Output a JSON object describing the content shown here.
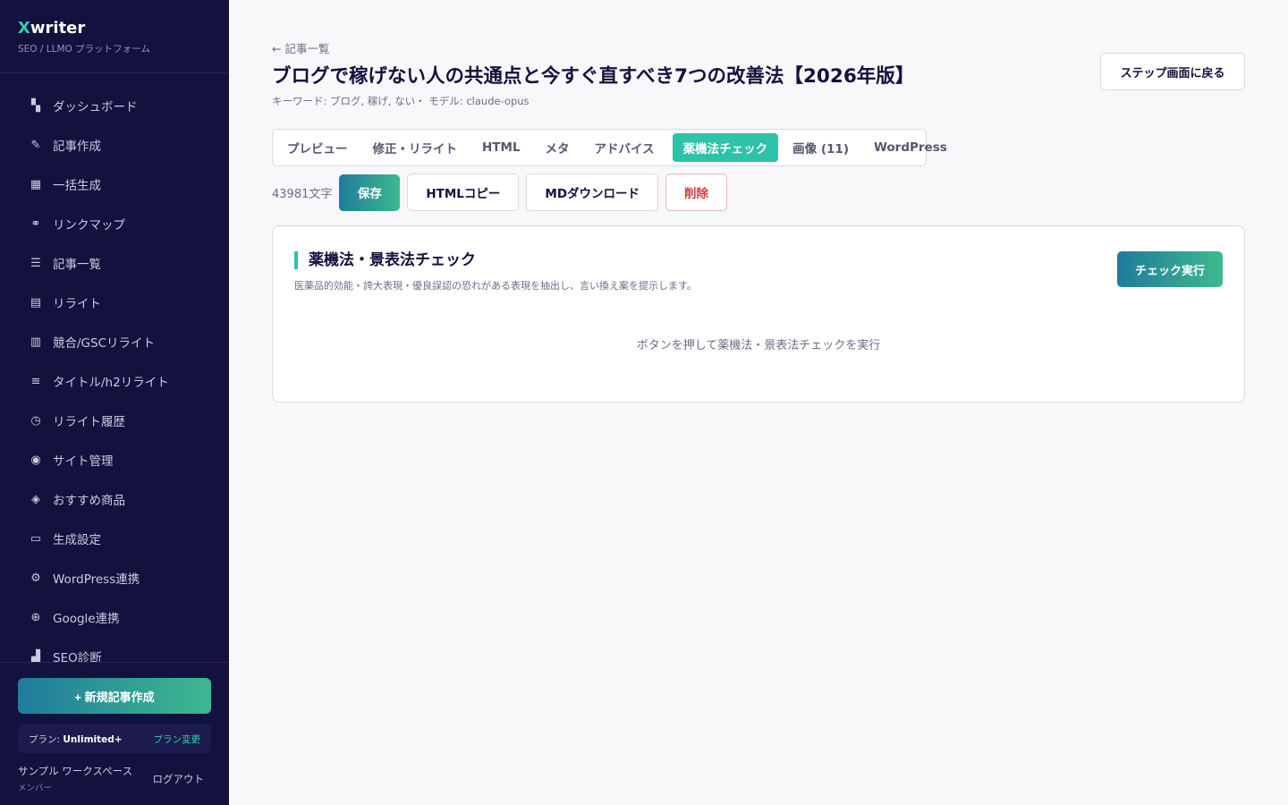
{
  "brand": {
    "x": "X",
    "rest": "writer",
    "subtitle": "SEO / LLMO プラットフォーム"
  },
  "sidebar": {
    "items": [
      {
        "label": "ダッシュボード",
        "icon": "dashboard-icon"
      },
      {
        "label": "記事作成",
        "icon": "pencil-icon"
      },
      {
        "label": "一括生成",
        "icon": "grid-add-icon"
      },
      {
        "label": "リンクマップ",
        "icon": "link-map-icon"
      },
      {
        "label": "記事一覧",
        "icon": "list-icon"
      },
      {
        "label": "リライト",
        "icon": "document-icon"
      },
      {
        "label": "競合/GSCリライト",
        "icon": "book-icon"
      },
      {
        "label": "タイトル/h2リライト",
        "icon": "heading-icon"
      },
      {
        "label": "リライト履歴",
        "icon": "clock-icon"
      },
      {
        "label": "サイト管理",
        "icon": "site-icon"
      },
      {
        "label": "おすすめ商品",
        "icon": "tag-icon"
      },
      {
        "label": "生成設定",
        "icon": "settings-box-icon"
      },
      {
        "label": "WordPress連携",
        "icon": "gear-icon"
      },
      {
        "label": "Google連携",
        "icon": "plus-circle-icon"
      },
      {
        "label": "SEO診断",
        "icon": "chart-icon"
      }
    ],
    "new_article": "+ 新規記事作成",
    "plan_label": "プラン:",
    "plan_name": "Unlimited+",
    "plan_change": "プラン変更",
    "workspace": "サンプル ワークスペース",
    "role": "メンバー",
    "logout": "ログアウト"
  },
  "header": {
    "back": "← 記事一覧",
    "title": "ブログで稼げない人の共通点と今すぐ直すべき7つの改善法【2026年版】",
    "meta": "キーワード: ブログ, 稼げ, ない・ モデル: claude-opus",
    "step_back": "ステップ画面に戻る"
  },
  "tabs": [
    {
      "label": "プレビュー",
      "active": false
    },
    {
      "label": "修正・リライト",
      "active": false
    },
    {
      "label": "HTML",
      "active": false
    },
    {
      "label": "メタ",
      "active": false
    },
    {
      "label": "アドバイス",
      "active": false
    },
    {
      "label": "薬機法チェック",
      "active": true
    },
    {
      "label": "画像 (11)",
      "active": false
    },
    {
      "label": "WordPress",
      "active": false
    }
  ],
  "toolbar": {
    "char_count": "43981文字",
    "save": "保存",
    "html_copy": "HTMLコピー",
    "md_download": "MDダウンロード",
    "delete": "削除"
  },
  "check_panel": {
    "title": "薬機法・景表法チェック",
    "description": "医薬品的効能・誇大表現・優良誤認の恐れがある表現を抽出し、言い換え案を提示します。",
    "run_button": "チェック実行",
    "empty_message": "ボタンを押して薬機法・景表法チェックを実行"
  },
  "colors": {
    "sidebar_bg": "#13113d",
    "accent": "#2cc3a7",
    "danger": "#d33a3a"
  }
}
